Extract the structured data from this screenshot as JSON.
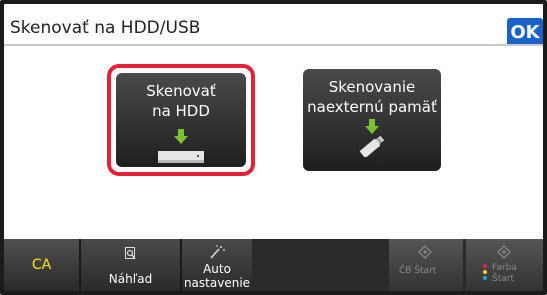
{
  "header": {
    "title": "Skenovať na HDD/USB",
    "ok_label": "OK"
  },
  "tiles": [
    {
      "label": "Skenovať\nna HDD",
      "selected": true,
      "icon": "hdd-icon"
    },
    {
      "label": "Skenovanie\nnaexternú pamäť",
      "selected": false,
      "icon": "usb-icon"
    }
  ],
  "bottom": {
    "ca_label": "CA",
    "preview_label": "Náhľad",
    "preview_icon": "magnifier-icon",
    "auto_label": "Auto nastavenie",
    "auto_icon": "magic-wand-icon",
    "bw_label": "ČB Štart",
    "color_label": "Farba Štart"
  },
  "colors": {
    "accent": "#1a62c9",
    "selection": "#e5213a",
    "ca": "#ffe400",
    "arrow": "#7ac231"
  }
}
